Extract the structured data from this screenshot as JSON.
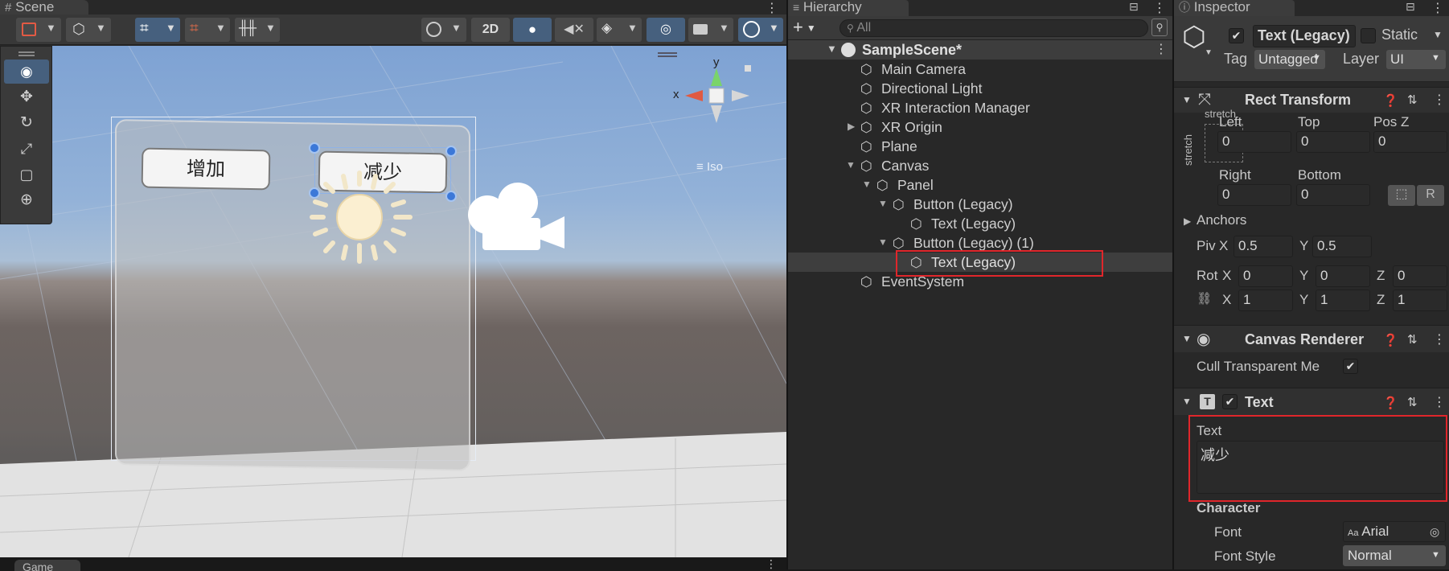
{
  "scene": {
    "tab_label": "Scene",
    "toolbar": {
      "mode_2d": "2D"
    },
    "gizmo": {
      "axis_y": "y",
      "axis_x": "x",
      "projection": "Iso"
    },
    "tools": [
      "view-tool",
      "move-tool",
      "rotate-tool",
      "scale-tool",
      "rect-tool",
      "transform-tool"
    ],
    "buttons": {
      "increase": "增加",
      "decrease": "减少"
    },
    "bottom_tab": "Game"
  },
  "hierarchy": {
    "tab_label": "Hierarchy",
    "search_placeholder": "All",
    "scene_name": "SampleScene*",
    "items": [
      {
        "label": "Main Camera"
      },
      {
        "label": "Directional Light"
      },
      {
        "label": "XR Interaction Manager"
      },
      {
        "label": "XR Origin"
      },
      {
        "label": "Plane"
      },
      {
        "label": "Canvas"
      },
      {
        "label": "Panel"
      },
      {
        "label": "Button (Legacy)"
      },
      {
        "label": "Text (Legacy)"
      },
      {
        "label": "Button (Legacy) (1)"
      },
      {
        "label": "Text (Legacy)"
      },
      {
        "label": "EventSystem"
      }
    ],
    "selected_index": 10,
    "highlight_color": "#e0262b"
  },
  "inspector": {
    "tab_label": "Inspector",
    "object_name": "Text (Legacy)",
    "static_label": "Static",
    "tag_label": "Tag",
    "tag_value": "Untagged",
    "layer_label": "Layer",
    "layer_value": "UI",
    "rect_transform": {
      "title": "Rect Transform",
      "stretch_top": "stretch",
      "stretch_side": "stretch",
      "left_label": "Left",
      "top_label": "Top",
      "posz_label": "Pos Z",
      "left": "0",
      "top": "0",
      "posz": "0",
      "right_label": "Right",
      "bottom_label": "Bottom",
      "right": "0",
      "bottom": "0",
      "r_button": "R",
      "anchors_label": "Anchors",
      "pivot_label": "Piv",
      "pivot_x_label": "X",
      "pivot_x": "0.5",
      "pivot_y_label": "Y",
      "pivot_y": "0.5",
      "rotation_label": "Rot",
      "rot_x": "0",
      "rot_y": "0",
      "rot_z": "0",
      "scale_x": "1",
      "scale_y": "1",
      "scale_z": "1",
      "axis_x": "X",
      "axis_y": "Y",
      "axis_z": "Z"
    },
    "canvas_renderer": {
      "title": "Canvas Renderer",
      "cull_label": "Cull Transparent Me"
    },
    "text_component": {
      "title": "Text",
      "text_label": "Text",
      "text_value": "减少",
      "character_label": "Character",
      "font_label": "Font",
      "font_value": "Arial",
      "font_style_label": "Font Style",
      "font_style_value": "Normal"
    }
  }
}
